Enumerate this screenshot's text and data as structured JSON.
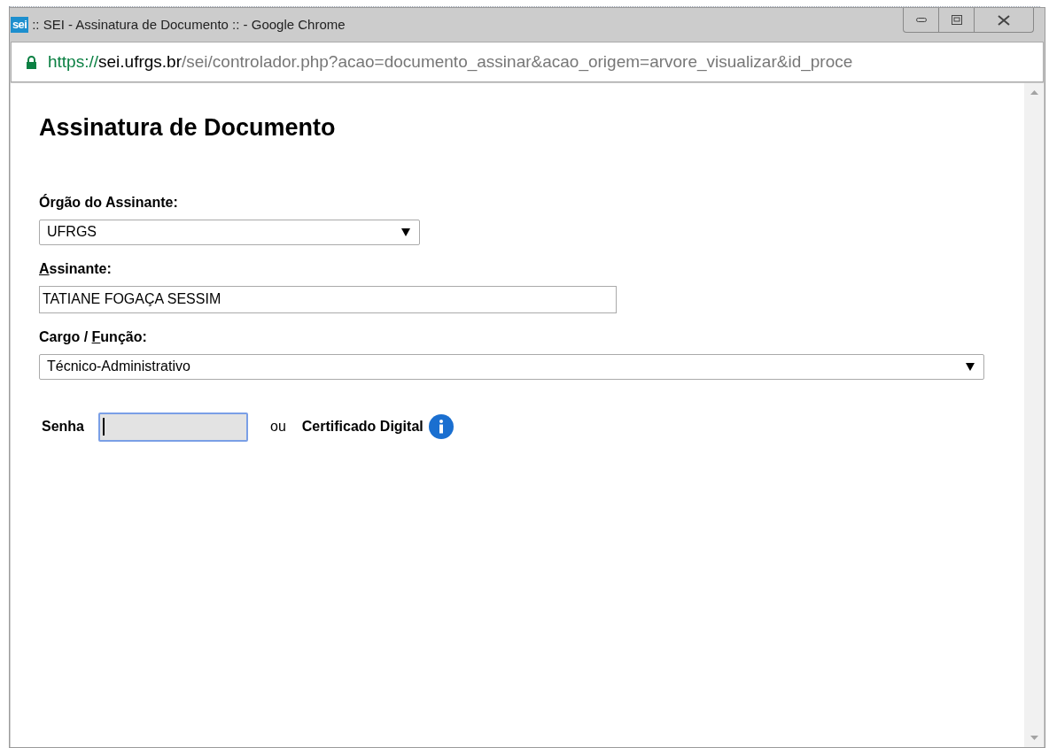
{
  "window": {
    "title": ":: SEI - Assinatura de Documento :: - Google Chrome",
    "logo": "sei"
  },
  "address_bar": {
    "scheme": "https://",
    "host": "sei.ufrgs.br",
    "path": "/sei/controlador.php?acao=documento_assinar&acao_origem=arvore_visualizar&id_proce"
  },
  "page": {
    "heading": "Assinatura de Documento",
    "fields": [
      {
        "kind": "select",
        "label": [
          {
            "text": "Órgão do Assinante:",
            "underline": false
          }
        ],
        "value": "UFRGS"
      },
      {
        "kind": "text",
        "label": [
          {
            "text": "A",
            "underline": true
          },
          {
            "text": "ssinante:",
            "underline": false
          }
        ],
        "value": "TATIANE FOGAÇA SESSIM"
      },
      {
        "kind": "select",
        "label": [
          {
            "text": "Cargo / ",
            "underline": false
          },
          {
            "text": "F",
            "underline": true
          },
          {
            "text": "unção:",
            "underline": false
          }
        ],
        "value": "Técnico-Administrativo"
      }
    ],
    "password": {
      "label": "Senha",
      "focused": true
    },
    "or_text": "ou",
    "certificate": {
      "label": "Certificado Digital"
    }
  }
}
